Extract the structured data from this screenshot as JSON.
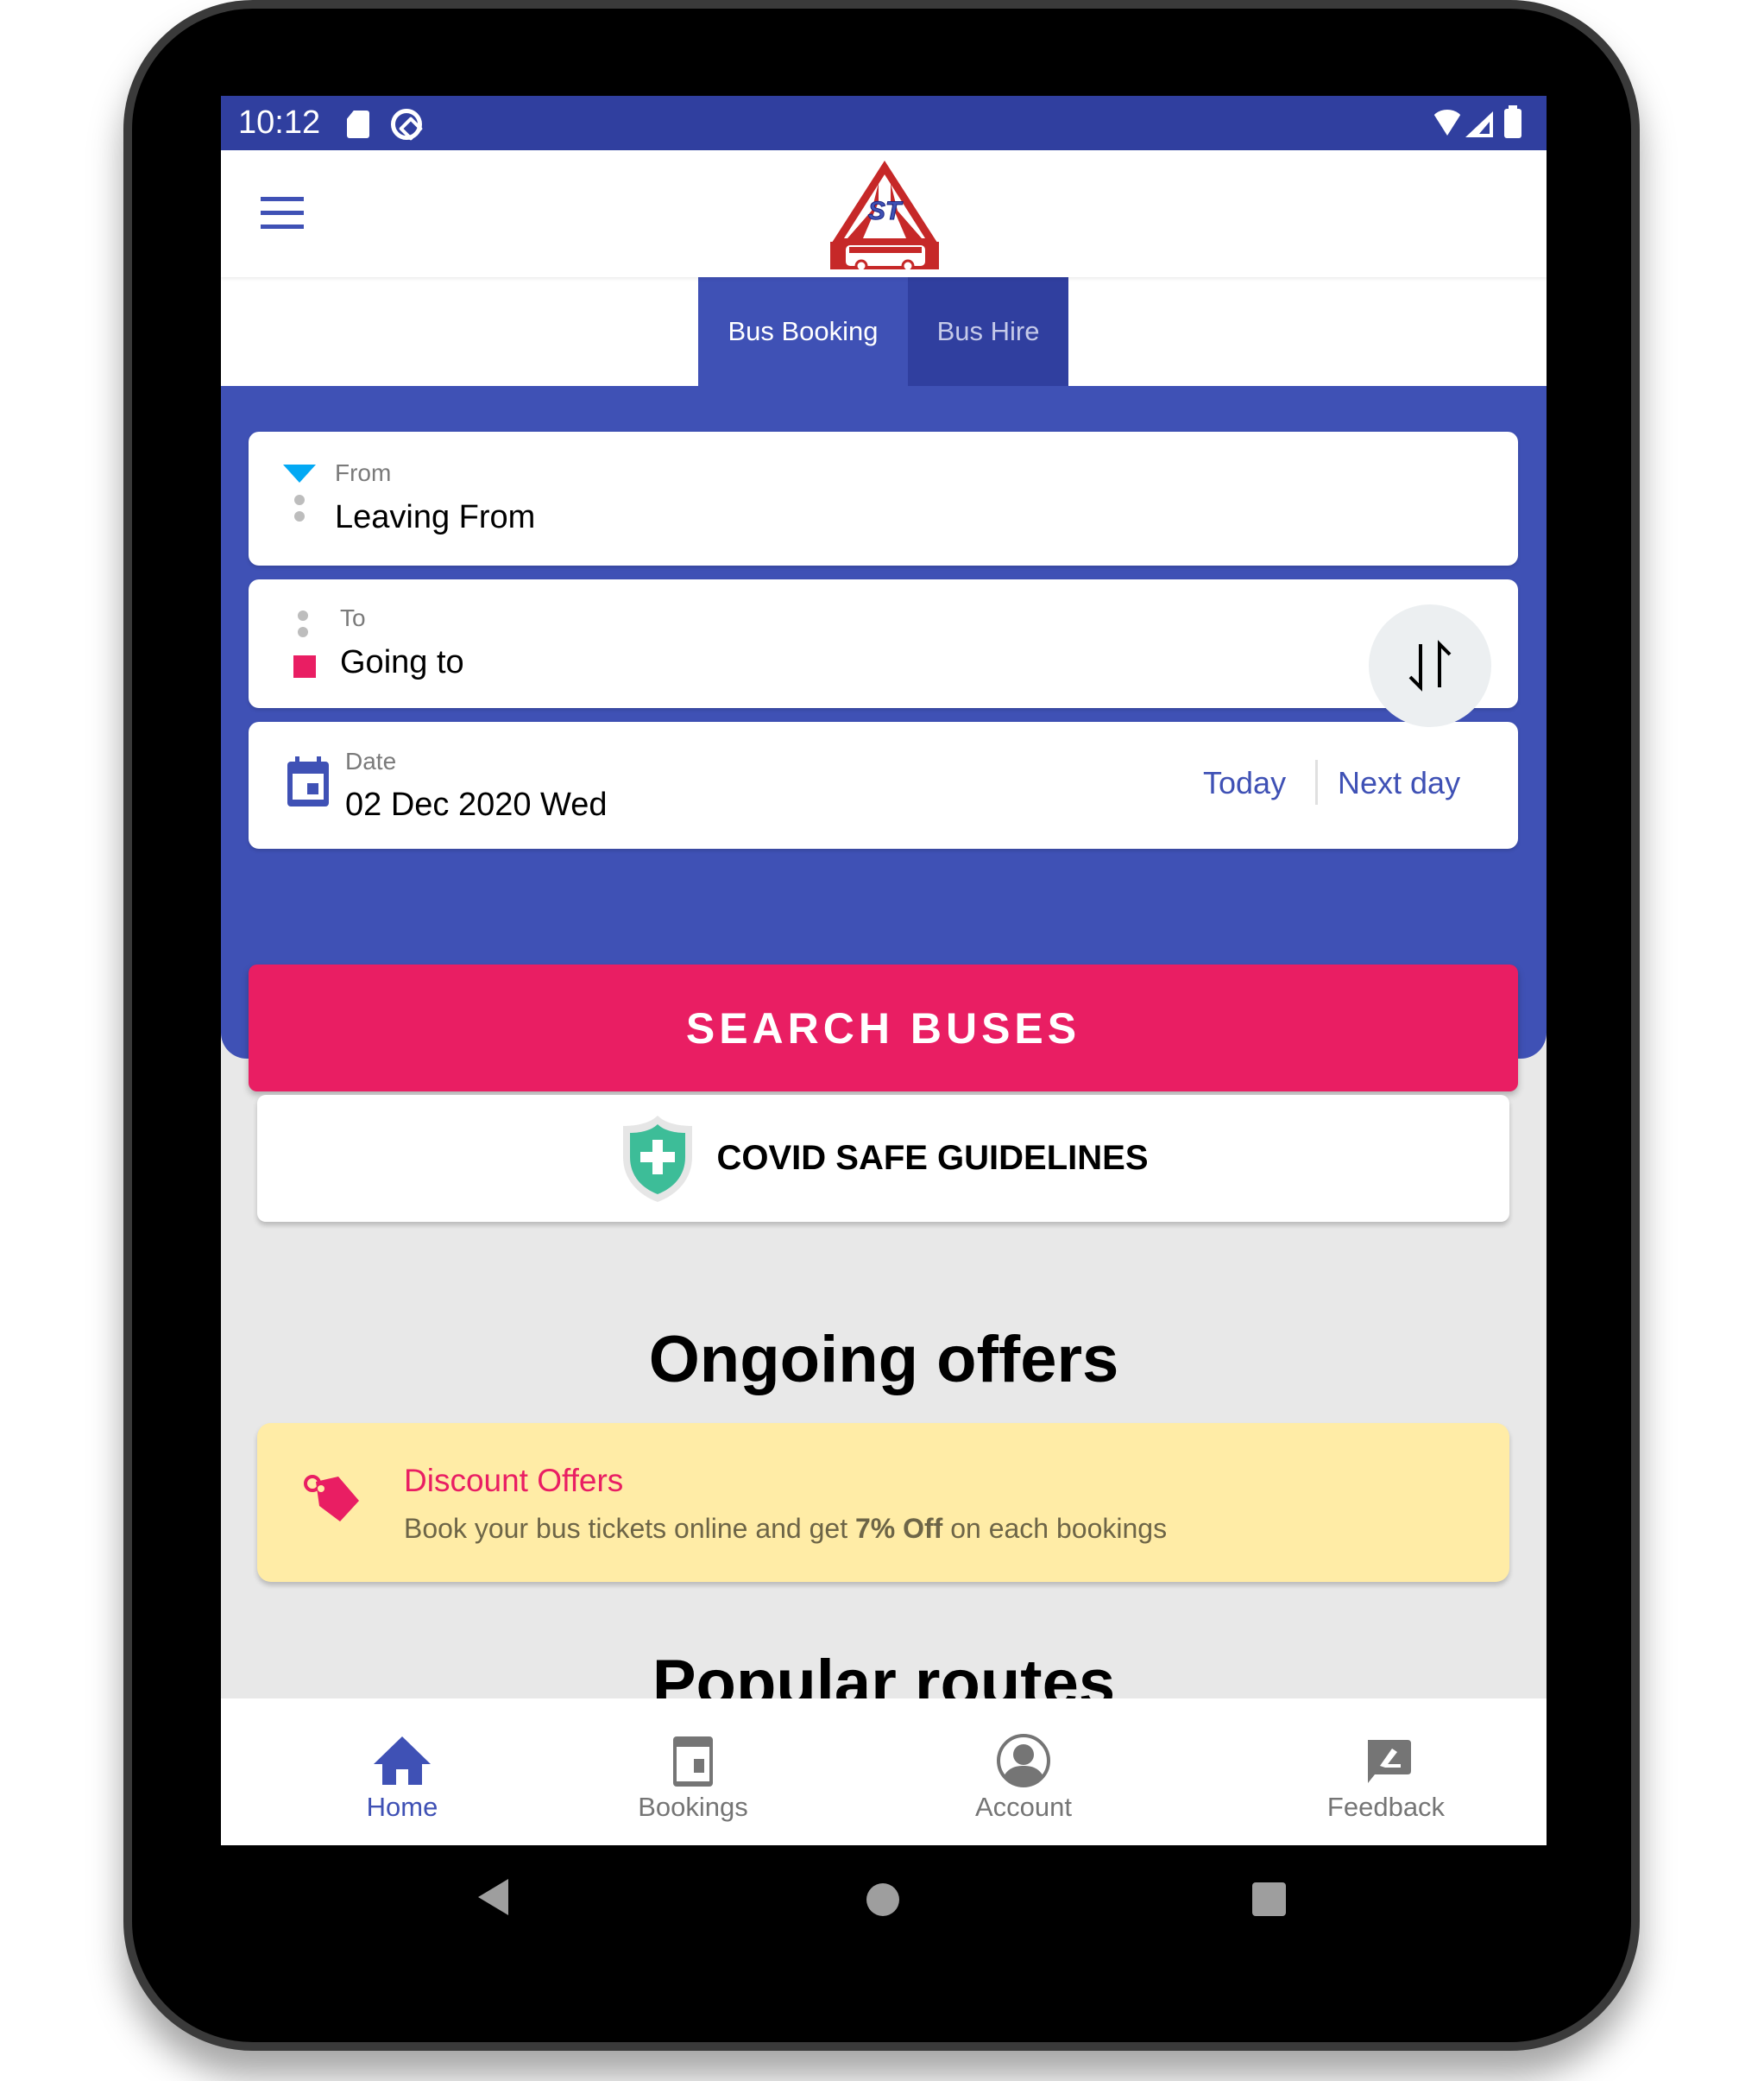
{
  "status_bar": {
    "time": "10:12",
    "icons": [
      "sd-card-icon",
      "data-saver-icon",
      "wifi-icon",
      "signal-icon",
      "battery-icon"
    ]
  },
  "toolbar": {
    "menu_icon": "hamburger-menu-icon",
    "logo_text": "ST",
    "logo_colors": {
      "red": "#c62828",
      "blue": "#3f51b5"
    }
  },
  "tabs": [
    {
      "label": "Bus Booking",
      "active": true
    },
    {
      "label": "Bus Hire",
      "active": false
    }
  ],
  "search": {
    "from": {
      "label": "From",
      "value": "Leaving From"
    },
    "to": {
      "label": "To",
      "value": "Going to"
    },
    "swap_icon": "swap-vertical-icon",
    "date": {
      "label": "Date",
      "value": "02 Dec 2020 Wed",
      "today_label": "Today",
      "next_day_label": "Next day"
    },
    "search_button_label": "SEARCH BUSES"
  },
  "covid": {
    "label": "COVID SAFE GUIDELINES",
    "icon": "shield-plus-icon"
  },
  "offers_section": {
    "title": "Ongoing offers",
    "offers": [
      {
        "title": "Discount Offers",
        "desc_prefix": "Book your bus tickets online and get ",
        "desc_highlight": "7% Off",
        "desc_suffix": " on each bookings",
        "icon": "price-tag-icon"
      }
    ]
  },
  "routes_section": {
    "title": "Popular routes"
  },
  "bottom_nav": [
    {
      "label": "Home",
      "icon": "home-icon",
      "active": true
    },
    {
      "label": "Bookings",
      "icon": "calendar-icon",
      "active": false
    },
    {
      "label": "Account",
      "icon": "account-circle-icon",
      "active": false
    },
    {
      "label": "Feedback",
      "icon": "feedback-icon",
      "active": false
    }
  ],
  "colors": {
    "primary": "#3f51b5",
    "primary_dark": "#303f9f",
    "accent": "#e91e63",
    "from_marker": "#03a9f4",
    "offer_bg": "#ffeca6",
    "covid_green": "#3dbd98",
    "inactive_gray": "#757575"
  }
}
